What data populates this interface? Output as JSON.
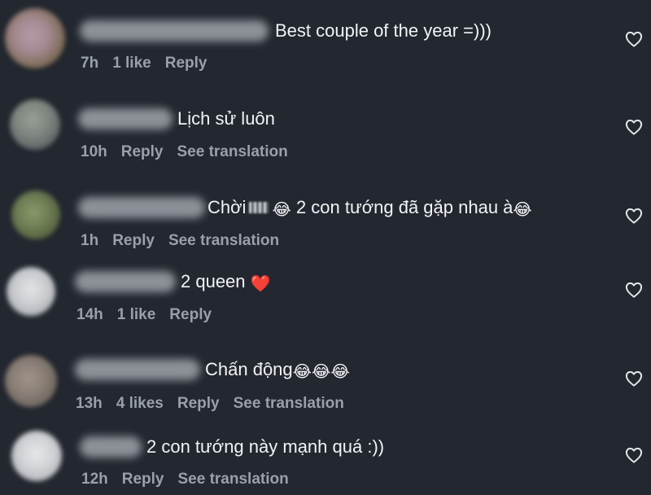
{
  "comments": [
    {
      "text": "Best couple of the year =)))",
      "time": "7h",
      "likes": "1 like",
      "reply": "Reply",
      "translate": ""
    },
    {
      "text": "Lịch sử luôn",
      "time": "10h",
      "likes": "",
      "reply": "Reply",
      "translate": "See translation"
    },
    {
      "text_before": "Chời",
      "text_after": "2 con tướng đã gặp nhau à",
      "emoji_a": "😂",
      "emoji_b": "😂",
      "time": "1h",
      "likes": "",
      "reply": "Reply",
      "translate": "See translation"
    },
    {
      "text": "2 queen",
      "emoji": "❤️",
      "time": "14h",
      "likes": "1 like",
      "reply": "Reply",
      "translate": ""
    },
    {
      "text": "Chấn động",
      "emoji": "😂😂😂",
      "time": "13h",
      "likes": "4 likes",
      "reply": "Reply",
      "translate": "See translation"
    },
    {
      "text": "2 con tướng này mạnh quá :))",
      "time": "12h",
      "likes": "",
      "reply": "Reply",
      "translate": "See translation"
    }
  ],
  "colors": {
    "background": "#23272f",
    "text": "#f2f3f5",
    "meta": "#9aa0a8",
    "heart_stroke": "#e4e6ea"
  },
  "icons": {
    "like": "heart-outline-icon"
  }
}
